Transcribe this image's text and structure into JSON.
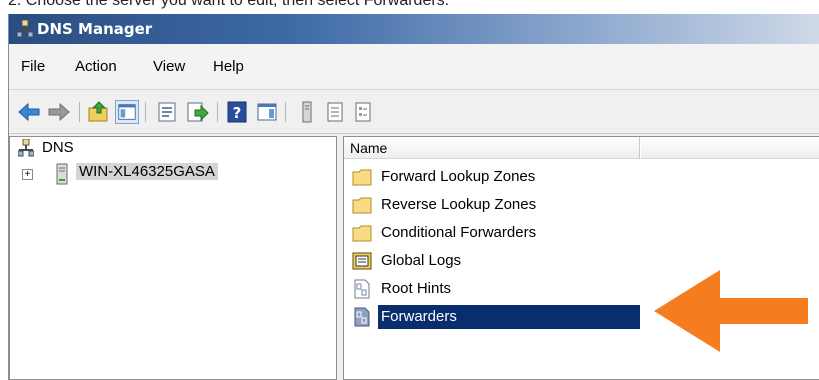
{
  "instruction": "2. Choose the server you want to edit, then select Forwarders.",
  "window": {
    "title": "DNS Manager"
  },
  "menu": [
    "File",
    "Action",
    "View",
    "Help"
  ],
  "tree": {
    "root": "DNS",
    "server": "WIN-XL46325GASA",
    "expander": "+"
  },
  "list": {
    "column_name": "Name",
    "items": [
      {
        "label": "Forward Lookup Zones",
        "icon": "folder-icon"
      },
      {
        "label": "Reverse Lookup Zones",
        "icon": "folder-icon"
      },
      {
        "label": "Conditional Forwarders",
        "icon": "folder-icon"
      },
      {
        "label": "Global Logs",
        "icon": "logs-icon"
      },
      {
        "label": "Root Hints",
        "icon": "binary-doc-icon"
      },
      {
        "label": "Forwarders",
        "icon": "binary-doc-icon",
        "selected": true
      }
    ]
  },
  "colors": {
    "selection": "#0a2d6e",
    "callout_arrow": "#f57c1f",
    "titlebar": "#2a4d80"
  }
}
